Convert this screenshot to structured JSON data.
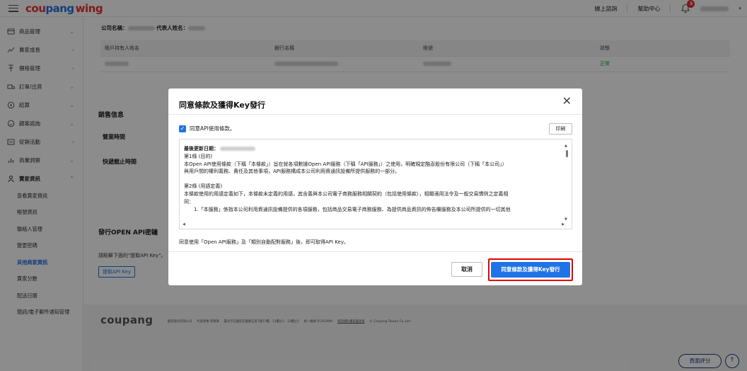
{
  "header": {
    "logo_part1": "cou",
    "logo_part2": "pang",
    "logo_part3": "wing",
    "links": [
      "線上諮詢",
      "幫助中心"
    ],
    "notification_count": "3",
    "brand_red": "#e8312f",
    "brand_blue": "#1f73e5"
  },
  "sidebar": {
    "items": [
      {
        "label": "商品管理",
        "icon": "product-box-icon"
      },
      {
        "label": "賣家成長",
        "icon": "growth-trend-icon"
      },
      {
        "label": "價格管理",
        "icon": "price-tag-icon"
      },
      {
        "label": "訂單/出貨",
        "icon": "order-truck-icon"
      },
      {
        "label": "結算",
        "icon": "settlement-coin-icon"
      },
      {
        "label": "顧客諮詢",
        "icon": "customer-chat-icon"
      },
      {
        "label": "促銷活動",
        "icon": "promotion-icon"
      },
      {
        "label": "商業洞察",
        "icon": "insight-chart-icon"
      },
      {
        "label": "賣家資訊",
        "icon": "seller-person-icon"
      }
    ],
    "sub_items": [
      "查看賣家資訊",
      "帳號資訊",
      "聯絡人管理",
      "變更密碼",
      "其他商家資訊",
      "賣家分數",
      "配送日曆",
      "簡訊/電子郵件通知管理"
    ],
    "active_sub": "其他商家資訊"
  },
  "main": {
    "company_label": "公司名稱：",
    "rep_label": "代表人姓名：",
    "bank_table": {
      "headers": [
        "賬戶持有人姓名",
        "銀行名稱",
        "賬號",
        "",
        "狀態"
      ],
      "status": "正常"
    },
    "sales_info_title": "銷售信息",
    "business_hours_label": "營業時間",
    "delivery_cutoff_label": "快遞截止時間",
    "open_api_title": "發行OPEN API密鑰",
    "open_api_hint": "請點擊下面的\"提取API Key\"。",
    "get_api_key_button": "提取API Key"
  },
  "footer": {
    "logo": "coupang",
    "company": "酷澎股份有限公司",
    "rep": "代表理事 邱德澤",
    "address": "臺北市信義區信義路五段7號17樓、13樓之1、13樓之2",
    "tax_id": "統一編號 91202999",
    "policy_link": "查詢隱私權保護政策",
    "copyright": "© Coupang Taiwan Co.,Ltd.",
    "rate_page_button": "頁面評分",
    "scroll_top_icon": "arrow-up-icon"
  },
  "modal": {
    "title": "同意條款及獲得Key發行",
    "close_icon": "close-x-icon",
    "checkbox_label": "同意API使用條款。",
    "checkbox_checked": true,
    "print_button": "印刷",
    "terms": {
      "last_updated_label": "最後更新日期：",
      "article1_title": "第1條 (目的)",
      "article1_line1": "本Open API使用條款（下稱「本條款」）旨在就各項數據Open API服務（下稱「API服務」）之使用，明確規定酷澎股份有限公司（下稱「本公司」）",
      "article1_line2": "與用戶間的權利義務、責任及其他事項，API服務構成本公司利用資通訊設備所提供服務的一部分。",
      "article2_title": "第2條 (用語定義)",
      "article2_line1": "本條款使用的用語定義如下，本條款未定義的用語，其含義與本公司電子商務服務相關契約（包括使用條款），相關適用法令及一般交易慣例之定義相",
      "article2_line2": "同：",
      "article2_item1": "1.「本服務」係指本公司利用資通訊設備提供的各項服務，包括商品交易電子商務服務、為提供商品資訊的佈告欄服務及本公司所提供的一切其他"
    },
    "note": "同意使用「Open API服務」及「類別自動配對服務」後，即可取得API Key。",
    "cancel_button": "取消",
    "agree_button": "同意條款及獲得Key發行",
    "highlight_color": "#e60000"
  }
}
